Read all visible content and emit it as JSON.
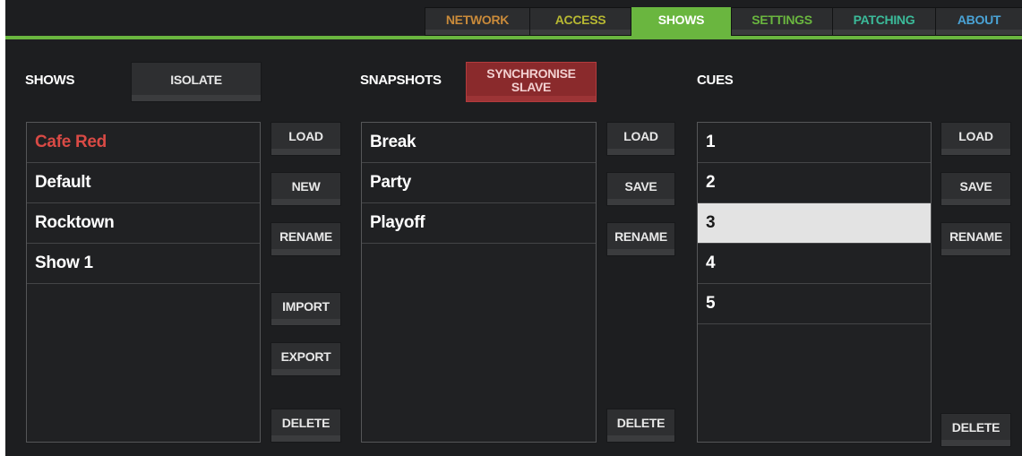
{
  "tabs": [
    {
      "label": "NETWORK",
      "color": "#c98a3a",
      "active": false
    },
    {
      "label": "ACCESS",
      "color": "#b7b832",
      "active": false
    },
    {
      "label": "SHOWS",
      "color": "#ffffff",
      "active": true
    },
    {
      "label": "SETTINGS",
      "color": "#6ab63f",
      "active": false
    },
    {
      "label": "PATCHING",
      "color": "#3bbb9a",
      "active": false
    },
    {
      "label": "ABOUT",
      "color": "#4aa3d6",
      "active": false
    }
  ],
  "accent_color": "#6ab63f",
  "shows": {
    "heading": "SHOWS",
    "isolate_label": "ISOLATE",
    "items": [
      "Cafe Red",
      "Default",
      "Rocktown",
      "Show 1"
    ],
    "active_item_color": "#d94a45",
    "buttons": {
      "load": "LOAD",
      "new": "NEW",
      "rename": "RENAME",
      "import": "IMPORT",
      "export": "EXPORT",
      "delete": "DELETE"
    }
  },
  "snapshots": {
    "heading": "SNAPSHOTS",
    "sync_line1": "SYNCHRONISE",
    "sync_line2": "SLAVE",
    "items": [
      "Break",
      "Party",
      "Playoff"
    ],
    "buttons": {
      "load": "LOAD",
      "save": "SAVE",
      "rename": "RENAME",
      "delete": "DELETE"
    }
  },
  "cues": {
    "heading": "CUES",
    "items": [
      "1",
      "2",
      "3",
      "4",
      "5"
    ],
    "selected": "3",
    "buttons": {
      "load": "LOAD",
      "save": "SAVE",
      "rename": "RENAME",
      "delete": "DELETE"
    }
  }
}
